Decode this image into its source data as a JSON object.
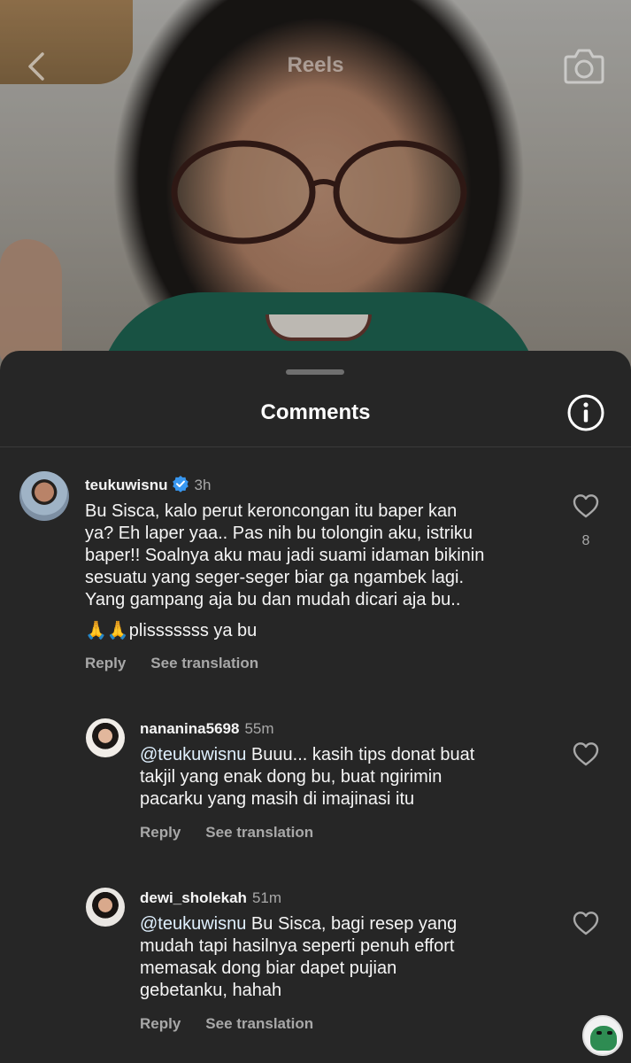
{
  "header": {
    "title": "Reels"
  },
  "sheet": {
    "title": "Comments"
  },
  "comments": [
    {
      "username": "teukuwisnu",
      "verified": true,
      "time": "3h",
      "text": "Bu Sisca, kalo perut keroncongan itu baper kan\nya? Eh laper yaa.. Pas nih bu tolongin aku, istriku\nbaper!! Soalnya aku mau jadi suami idaman bikinin\nsesuatu yang seger-seger biar ga ngambek lagi.\nYang gampang aja bu dan mudah dicari aja bu..",
      "emoji_line": "🙏🙏plisssssss ya bu",
      "reply_label": "Reply",
      "translate_label": "See translation",
      "likes": "8"
    },
    {
      "username": "nananina5698",
      "time": "55m",
      "mention": "@teukuwisnu",
      "text": " Buuu... kasih tips donat buat\ntakjil yang enak dong bu, buat ngirimin\npacarku yang masih di imajinasi itu",
      "reply_label": "Reply",
      "translate_label": "See translation"
    },
    {
      "username": "dewi_sholekah",
      "time": "51m",
      "mention": "@teukuwisnu",
      "text": " Bu Sisca, bagi resep yang\nmudah tapi hasilnya seperti penuh effort\nmemasak dong biar dapet pujian\ngebetanku, hahah",
      "reply_label": "Reply",
      "translate_label": "See translation"
    }
  ],
  "colors": {
    "sheet_bg": "#262626",
    "secondary_text": "#a8a8a8",
    "verified_blue": "#3897f0"
  }
}
